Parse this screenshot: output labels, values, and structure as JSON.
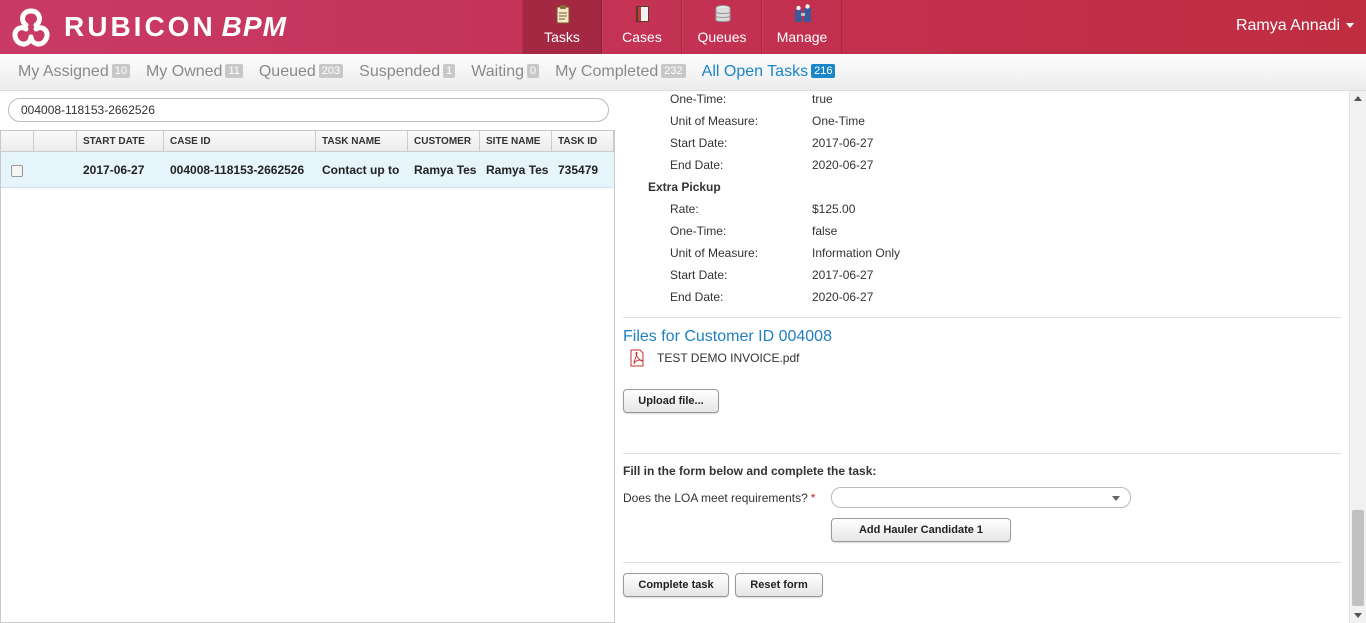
{
  "app": {
    "brand": "RUBICON",
    "brand_suffix": "BPM",
    "user_name": "Ramya Annadi"
  },
  "nav": [
    {
      "label": "Tasks",
      "icon": "tasks-clipboard-icon",
      "active": true
    },
    {
      "label": "Cases",
      "icon": "cases-book-icon",
      "active": false
    },
    {
      "label": "Queues",
      "icon": "queues-database-icon",
      "active": false
    },
    {
      "label": "Manage",
      "icon": "manage-people-icon",
      "active": false
    }
  ],
  "subnav": [
    {
      "label": "My Assigned",
      "count": "10"
    },
    {
      "label": "My Owned",
      "count": "11"
    },
    {
      "label": "Queued",
      "count": "203"
    },
    {
      "label": "Suspended",
      "count": "1"
    },
    {
      "label": "Waiting",
      "count": "0"
    },
    {
      "label": "My Completed",
      "count": "232"
    },
    {
      "label": "All Open Tasks",
      "count": "216"
    }
  ],
  "search": {
    "value": "004008-118153-2662526"
  },
  "table": {
    "columns": [
      "",
      "",
      "START DATE",
      "CASE ID",
      "TASK NAME",
      "CUSTOMER",
      "SITE NAME",
      "TASK ID"
    ],
    "rows": [
      [
        "",
        "",
        "2017-06-27",
        "004008-118153-2662526",
        "Contact up to",
        "Ramya Tes",
        "Ramya Tes",
        "735479"
      ]
    ]
  },
  "detail": {
    "items_top": [
      {
        "k": "One-Time:",
        "v": "true"
      },
      {
        "k": "Unit of Measure:",
        "v": "One-Time"
      },
      {
        "k": "Start Date:",
        "v": "2017-06-27"
      },
      {
        "k": "End Date:",
        "v": "2020-06-27"
      }
    ],
    "section": "Extra Pickup",
    "items_extra": [
      {
        "k": "Rate:",
        "v": "$125.00"
      },
      {
        "k": "One-Time:",
        "v": "false"
      },
      {
        "k": "Unit of Measure:",
        "v": "Information Only"
      },
      {
        "k": "Start Date:",
        "v": "2017-06-27"
      },
      {
        "k": "End Date:",
        "v": "2020-06-27"
      }
    ],
    "files_title": "Files for Customer ID 004008",
    "file_name": "TEST DEMO INVOICE.pdf",
    "upload_label": "Upload file...",
    "form_intro": "Fill in the form below and complete the task:",
    "question": "Does the LOA meet requirements?",
    "required_mark": "*",
    "select_value": "",
    "add_hauler_label": "Add Hauler Candidate 1",
    "complete_label": "Complete task",
    "reset_label": "Reset form"
  }
}
